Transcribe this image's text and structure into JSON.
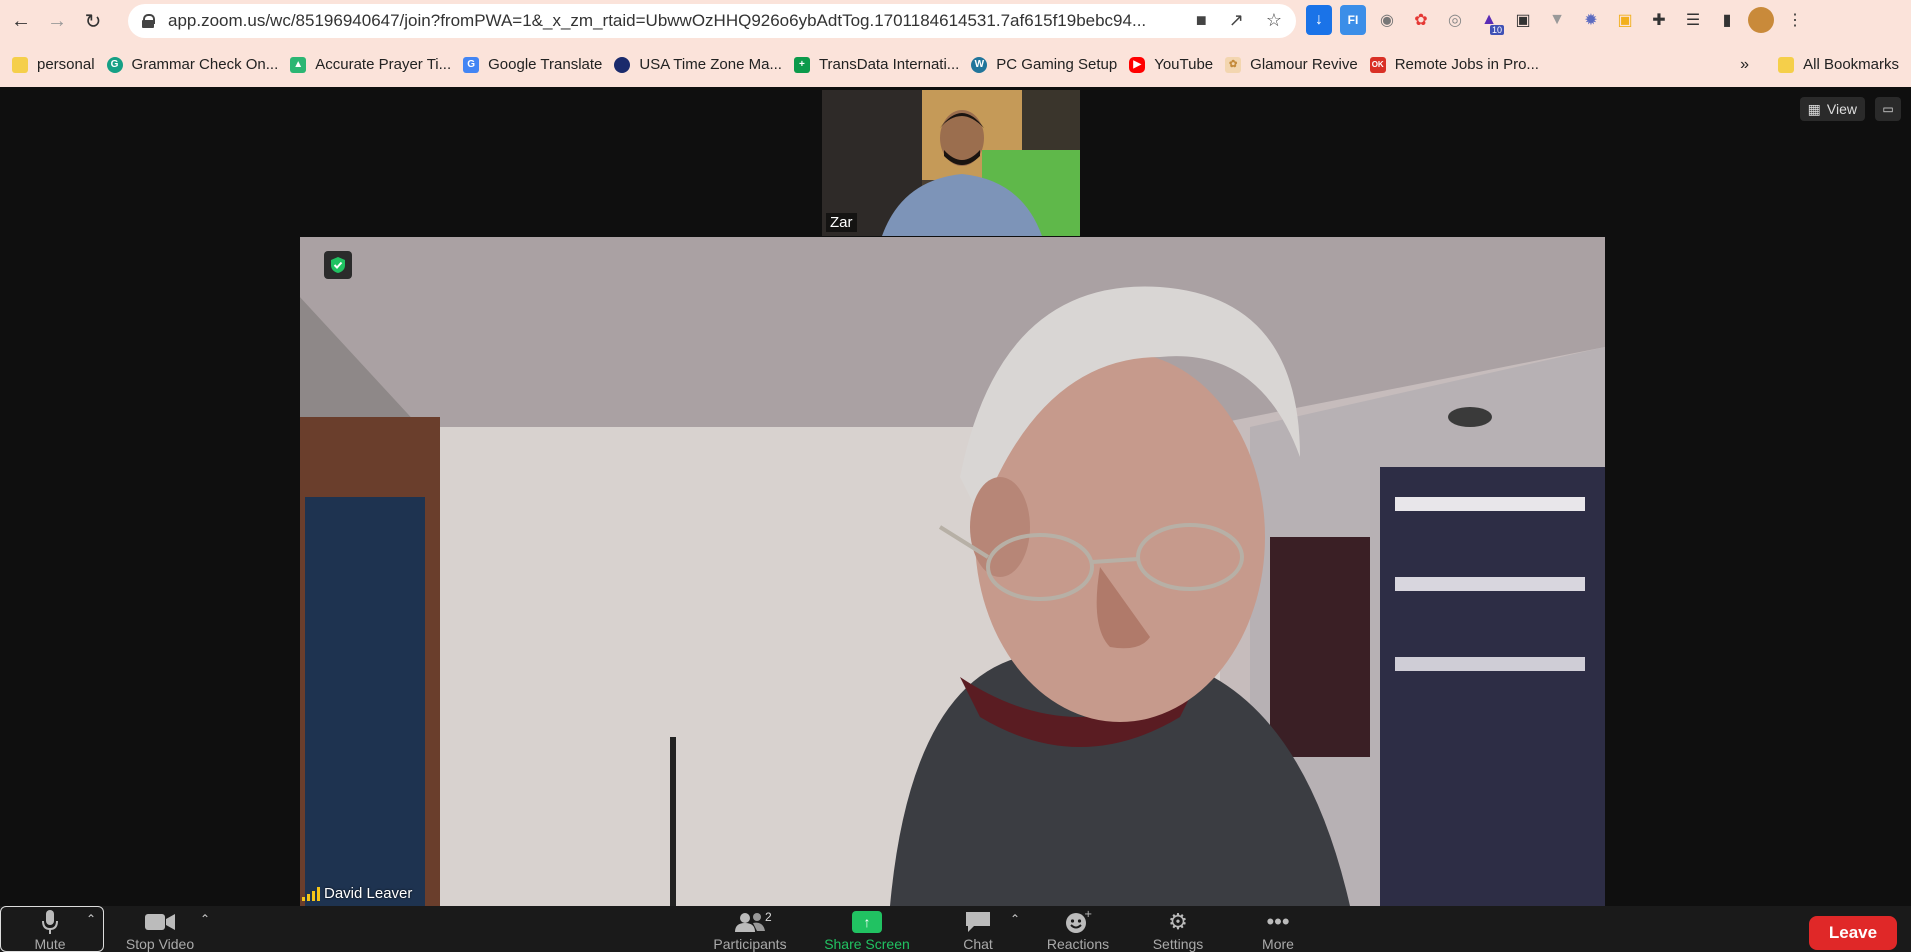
{
  "browser": {
    "url": "app.zoom.us/wc/85196940647/join?fromPWA=1&_x_zm_rtaid=UbwwOzHHQ926o6ybAdtTog.1701184614531.7af615f19bebc94...",
    "extension_badge": "10"
  },
  "bookmarks": [
    {
      "label": "personal",
      "icon": "folder-icon",
      "color": "#f5cf4a"
    },
    {
      "label": "Grammar Check On...",
      "icon": "grammarly-icon",
      "color": "#15a085"
    },
    {
      "label": "Accurate Prayer Ti...",
      "icon": "mosque-icon",
      "color": "#2bb673"
    },
    {
      "label": "Google Translate",
      "icon": "translate-icon",
      "color": "#4285f4"
    },
    {
      "label": "USA Time Zone Ma...",
      "icon": "globe-icon",
      "color": "#1a2a6c"
    },
    {
      "label": "TransData Internati...",
      "icon": "plus-icon",
      "color": "#0c9a4b"
    },
    {
      "label": "PC Gaming Setup",
      "icon": "wordpress-icon",
      "color": "#21759b"
    },
    {
      "label": "YouTube",
      "icon": "youtube-icon",
      "color": "#ff0000"
    },
    {
      "label": "Glamour Revive",
      "icon": "glamour-icon",
      "color": "#e8b26a"
    },
    {
      "label": "Remote Jobs in Pro...",
      "icon": "ok-icon",
      "color": "#d93025"
    }
  ],
  "all_bookmarks": "All Bookmarks",
  "zoom": {
    "view_label": "View",
    "thumbnail_name": "Zar",
    "speaker_name": "David Leaver",
    "toolbar": {
      "mute": "Mute",
      "stop_video": "Stop Video",
      "participants": "Participants",
      "participants_count": "2",
      "share_screen": "Share Screen",
      "chat": "Chat",
      "reactions": "Reactions",
      "settings": "Settings",
      "more": "More",
      "leave": "Leave"
    }
  },
  "colors": {
    "chrome_bar": "#fbe3da",
    "share_green": "#21c262",
    "leave_red": "#e02828",
    "signal_yellow": "#f5c518"
  }
}
